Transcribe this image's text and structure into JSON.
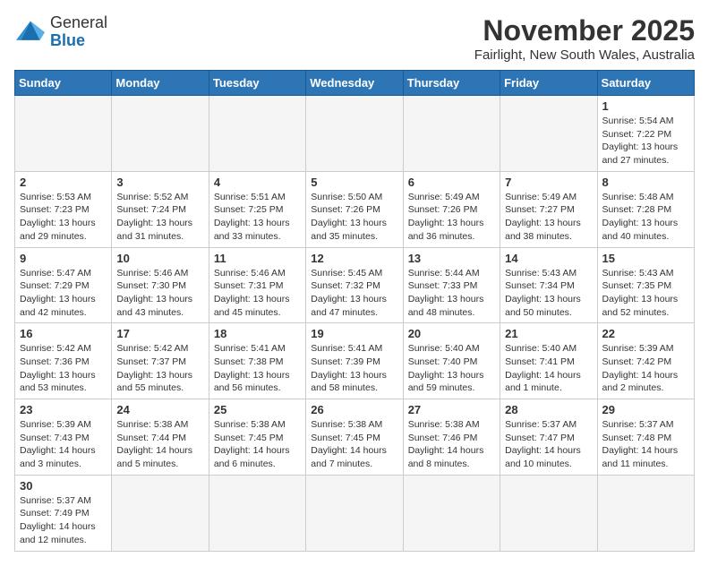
{
  "header": {
    "logo_general": "General",
    "logo_blue": "Blue",
    "month_title": "November 2025",
    "subtitle": "Fairlight, New South Wales, Australia"
  },
  "weekdays": [
    "Sunday",
    "Monday",
    "Tuesday",
    "Wednesday",
    "Thursday",
    "Friday",
    "Saturday"
  ],
  "weeks": [
    [
      {
        "day": "",
        "info": ""
      },
      {
        "day": "",
        "info": ""
      },
      {
        "day": "",
        "info": ""
      },
      {
        "day": "",
        "info": ""
      },
      {
        "day": "",
        "info": ""
      },
      {
        "day": "",
        "info": ""
      },
      {
        "day": "1",
        "info": "Sunrise: 5:54 AM\nSunset: 7:22 PM\nDaylight: 13 hours\nand 27 minutes."
      }
    ],
    [
      {
        "day": "2",
        "info": "Sunrise: 5:53 AM\nSunset: 7:23 PM\nDaylight: 13 hours\nand 29 minutes."
      },
      {
        "day": "3",
        "info": "Sunrise: 5:52 AM\nSunset: 7:24 PM\nDaylight: 13 hours\nand 31 minutes."
      },
      {
        "day": "4",
        "info": "Sunrise: 5:51 AM\nSunset: 7:25 PM\nDaylight: 13 hours\nand 33 minutes."
      },
      {
        "day": "5",
        "info": "Sunrise: 5:50 AM\nSunset: 7:26 PM\nDaylight: 13 hours\nand 35 minutes."
      },
      {
        "day": "6",
        "info": "Sunrise: 5:49 AM\nSunset: 7:26 PM\nDaylight: 13 hours\nand 36 minutes."
      },
      {
        "day": "7",
        "info": "Sunrise: 5:49 AM\nSunset: 7:27 PM\nDaylight: 13 hours\nand 38 minutes."
      },
      {
        "day": "8",
        "info": "Sunrise: 5:48 AM\nSunset: 7:28 PM\nDaylight: 13 hours\nand 40 minutes."
      }
    ],
    [
      {
        "day": "9",
        "info": "Sunrise: 5:47 AM\nSunset: 7:29 PM\nDaylight: 13 hours\nand 42 minutes."
      },
      {
        "day": "10",
        "info": "Sunrise: 5:46 AM\nSunset: 7:30 PM\nDaylight: 13 hours\nand 43 minutes."
      },
      {
        "day": "11",
        "info": "Sunrise: 5:46 AM\nSunset: 7:31 PM\nDaylight: 13 hours\nand 45 minutes."
      },
      {
        "day": "12",
        "info": "Sunrise: 5:45 AM\nSunset: 7:32 PM\nDaylight: 13 hours\nand 47 minutes."
      },
      {
        "day": "13",
        "info": "Sunrise: 5:44 AM\nSunset: 7:33 PM\nDaylight: 13 hours\nand 48 minutes."
      },
      {
        "day": "14",
        "info": "Sunrise: 5:43 AM\nSunset: 7:34 PM\nDaylight: 13 hours\nand 50 minutes."
      },
      {
        "day": "15",
        "info": "Sunrise: 5:43 AM\nSunset: 7:35 PM\nDaylight: 13 hours\nand 52 minutes."
      }
    ],
    [
      {
        "day": "16",
        "info": "Sunrise: 5:42 AM\nSunset: 7:36 PM\nDaylight: 13 hours\nand 53 minutes."
      },
      {
        "day": "17",
        "info": "Sunrise: 5:42 AM\nSunset: 7:37 PM\nDaylight: 13 hours\nand 55 minutes."
      },
      {
        "day": "18",
        "info": "Sunrise: 5:41 AM\nSunset: 7:38 PM\nDaylight: 13 hours\nand 56 minutes."
      },
      {
        "day": "19",
        "info": "Sunrise: 5:41 AM\nSunset: 7:39 PM\nDaylight: 13 hours\nand 58 minutes."
      },
      {
        "day": "20",
        "info": "Sunrise: 5:40 AM\nSunset: 7:40 PM\nDaylight: 13 hours\nand 59 minutes."
      },
      {
        "day": "21",
        "info": "Sunrise: 5:40 AM\nSunset: 7:41 PM\nDaylight: 14 hours\nand 1 minute."
      },
      {
        "day": "22",
        "info": "Sunrise: 5:39 AM\nSunset: 7:42 PM\nDaylight: 14 hours\nand 2 minutes."
      }
    ],
    [
      {
        "day": "23",
        "info": "Sunrise: 5:39 AM\nSunset: 7:43 PM\nDaylight: 14 hours\nand 3 minutes."
      },
      {
        "day": "24",
        "info": "Sunrise: 5:38 AM\nSunset: 7:44 PM\nDaylight: 14 hours\nand 5 minutes."
      },
      {
        "day": "25",
        "info": "Sunrise: 5:38 AM\nSunset: 7:45 PM\nDaylight: 14 hours\nand 6 minutes."
      },
      {
        "day": "26",
        "info": "Sunrise: 5:38 AM\nSunset: 7:45 PM\nDaylight: 14 hours\nand 7 minutes."
      },
      {
        "day": "27",
        "info": "Sunrise: 5:38 AM\nSunset: 7:46 PM\nDaylight: 14 hours\nand 8 minutes."
      },
      {
        "day": "28",
        "info": "Sunrise: 5:37 AM\nSunset: 7:47 PM\nDaylight: 14 hours\nand 10 minutes."
      },
      {
        "day": "29",
        "info": "Sunrise: 5:37 AM\nSunset: 7:48 PM\nDaylight: 14 hours\nand 11 minutes."
      }
    ],
    [
      {
        "day": "30",
        "info": "Sunrise: 5:37 AM\nSunset: 7:49 PM\nDaylight: 14 hours\nand 12 minutes."
      },
      {
        "day": "",
        "info": ""
      },
      {
        "day": "",
        "info": ""
      },
      {
        "day": "",
        "info": ""
      },
      {
        "day": "",
        "info": ""
      },
      {
        "day": "",
        "info": ""
      },
      {
        "day": "",
        "info": ""
      }
    ]
  ]
}
